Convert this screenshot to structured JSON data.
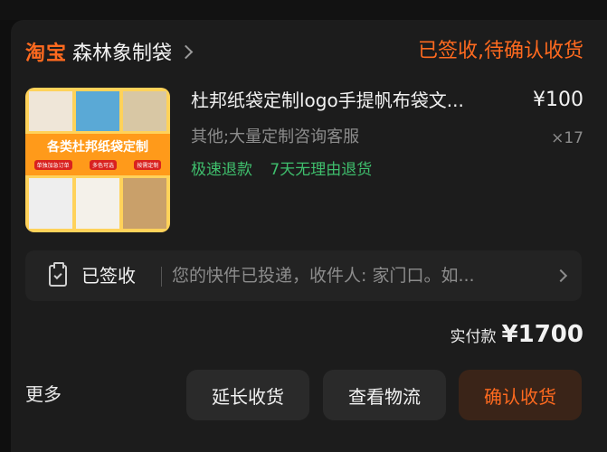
{
  "order": {
    "platform": "淘宝",
    "shop_name": "森林象制袋",
    "status": "已签收,待确认收货"
  },
  "product": {
    "thumbnail_banner": "各类杜邦纸袋定制",
    "thumbnail_tags": [
      "单独加急订单",
      "多色可选",
      "按需定制"
    ],
    "title": "杜邦纸袋定制logo手提帆布袋文...",
    "price": "¥100",
    "spec": "其他;大量定制咨询客服",
    "quantity": "×17",
    "perks": [
      "极速退款",
      "7天无理由退货"
    ]
  },
  "logistics": {
    "status": "已签收",
    "message": "您的快件已投递，收件人: 家门口。如..."
  },
  "payment": {
    "label": "实付款",
    "amount": "¥1700"
  },
  "actions": {
    "more": "更多",
    "extend": "延长收货",
    "track": "查看物流",
    "confirm": "确认收货"
  },
  "colors": {
    "accent": "#ff6a1f",
    "perk_green": "#3fbf6d",
    "background": "#1c1c1c"
  }
}
